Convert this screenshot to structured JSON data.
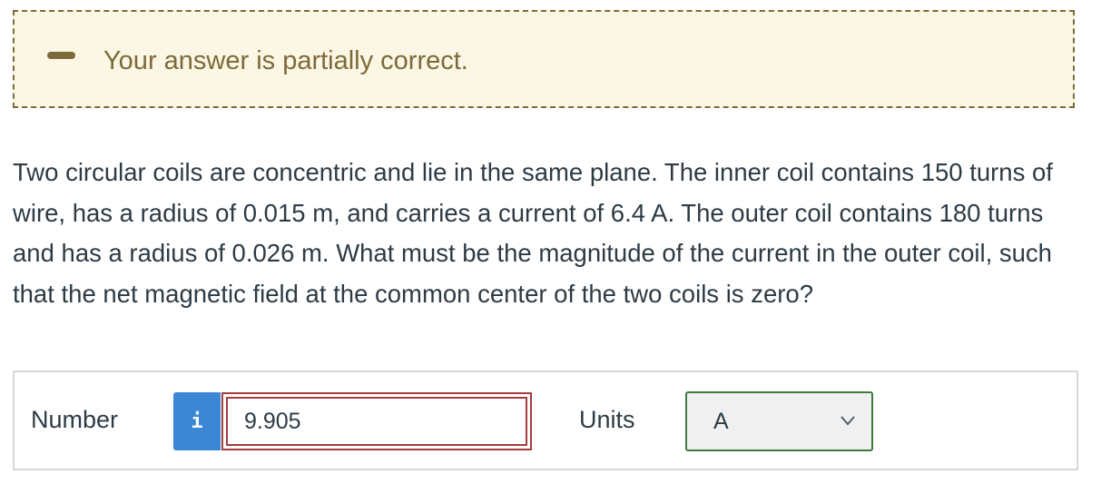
{
  "feedback": {
    "message": "Your answer is partially correct.",
    "icon": "partial-credit-dash-icon",
    "color": "#7d6a3a",
    "background": "#fcf6e4"
  },
  "question": {
    "text": "Two circular coils are concentric and lie in the same plane. The inner coil contains 150 turns of wire, has a radius of 0.015 m, and carries a current of 6.4 A. The outer coil contains 180 turns and has a radius of 0.026 m. What must be the magnitude of the current in the outer coil, such that the net magnetic field at the common center of the two coils is zero?"
  },
  "answer": {
    "number_label": "Number",
    "info_icon": "i",
    "number_value": "9.905",
    "units_label": "Units",
    "units_selected": "A",
    "incorrect_color": "#a33d3d",
    "correct_color": "#3f7a3f",
    "info_color": "#3b87d6"
  }
}
